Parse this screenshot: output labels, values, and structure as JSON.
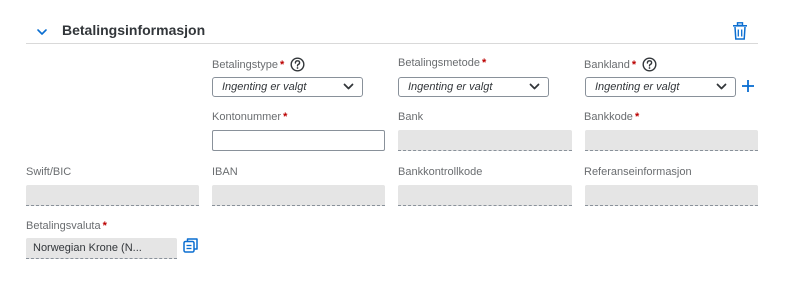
{
  "section": {
    "title": "Betalingsinformasjon"
  },
  "fields": {
    "betalingstype": {
      "label": "Betalingstype",
      "value": "Ingenting er valgt"
    },
    "betalingsmetode": {
      "label": "Betalingsmetode",
      "value": "Ingenting er valgt"
    },
    "bankland": {
      "label": "Bankland",
      "value": "Ingenting er valgt"
    },
    "kontonummer": {
      "label": "Kontonummer",
      "value": ""
    },
    "bank": {
      "label": "Bank",
      "value": ""
    },
    "bankkode": {
      "label": "Bankkode",
      "value": ""
    },
    "swift": {
      "label": "Swift/BIC",
      "value": ""
    },
    "iban": {
      "label": "IBAN",
      "value": ""
    },
    "bankkontrollkode": {
      "label": "Bankkontrollkode",
      "value": ""
    },
    "referanseinformasjon": {
      "label": "Referanseinformasjon",
      "value": ""
    },
    "betalingsvaluta": {
      "label": "Betalingsvaluta",
      "value": "Norwegian Krone (N..."
    }
  },
  "required_marker": "*",
  "colors": {
    "accent": "#0a6ed1",
    "required": "#bb0000",
    "readonly_bg": "#e5e5e5",
    "label": "#6a6d70"
  },
  "icons": {
    "collapse": "chevron-down-icon",
    "delete": "trash-icon",
    "help": "question-mark-circle-icon",
    "add": "plus-icon",
    "value_help": "value-help-icon"
  }
}
